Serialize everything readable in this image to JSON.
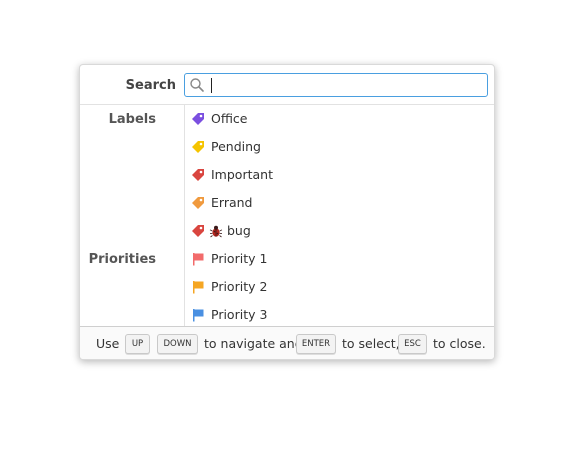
{
  "search": {
    "label": "Search",
    "value": ""
  },
  "sections": {
    "labels_title": "Labels",
    "priorities_title": "Priorities"
  },
  "labels": [
    {
      "name": "Office",
      "color": "#7b4fe0",
      "icon": "tag-icon"
    },
    {
      "name": "Pending",
      "color": "#f5c400",
      "icon": "tag-icon"
    },
    {
      "name": "Important",
      "color": "#d9453f",
      "icon": "tag-icon"
    },
    {
      "name": "Errand",
      "color": "#f09a3e",
      "icon": "tag-icon"
    },
    {
      "name": "bug",
      "color": "#d9453f",
      "icon": "tag-icon",
      "emoji": "bug-emoji"
    }
  ],
  "priorities": [
    {
      "name": "Priority 1",
      "color": "#f26b6b",
      "icon": "flag-icon"
    },
    {
      "name": "Priority 2",
      "color": "#f5a623",
      "icon": "flag-icon"
    },
    {
      "name": "Priority 3",
      "color": "#4a90e2",
      "icon": "flag-icon"
    }
  ],
  "footer": {
    "use": "Use",
    "up_key": "UP",
    "down_key": "DOWN",
    "navigate": "to navigate and",
    "enter_key": "ENTER",
    "select": "to select,",
    "esc_key": "ESC",
    "close": "to close."
  }
}
